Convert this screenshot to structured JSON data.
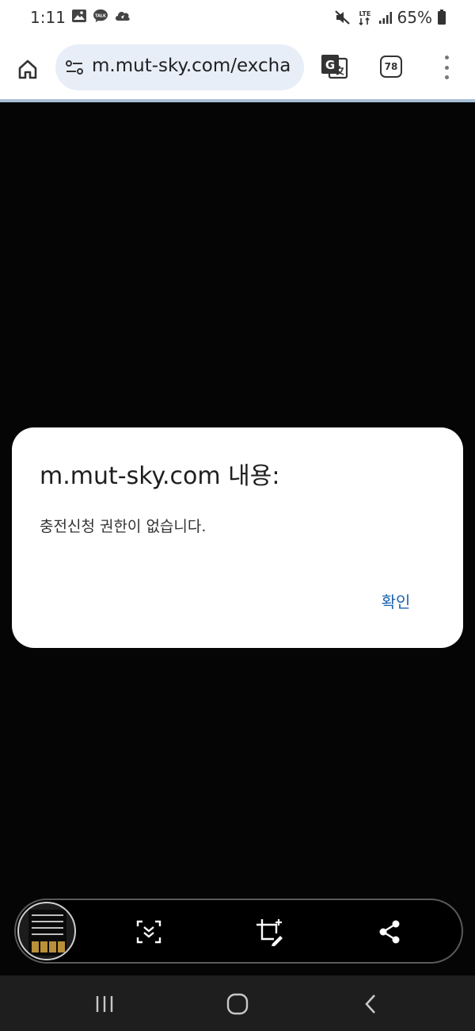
{
  "status_bar": {
    "time": "1:11",
    "talk_badge": "TALK",
    "network": "LTE",
    "battery_percent": "65%",
    "icons": [
      "gallery-icon",
      "kakaotalk-icon",
      "cloud-icon",
      "mute-icon",
      "lte-icon",
      "signal-icon",
      "battery-icon"
    ]
  },
  "browser": {
    "url": "m.mut-sky.com/excha",
    "tab_count": "78",
    "accent_line_color": "#a9bfd8"
  },
  "dialog": {
    "title": "m.mut-sky.com 내용:",
    "message": "충전신청 권한이 없습니다.",
    "ok_label": "확인",
    "ok_color": "#1a63b0"
  },
  "screenshot_toolbar": {
    "icons": [
      "screenshot-thumbnail",
      "scroll-capture-icon",
      "crop-edit-icon",
      "share-icon"
    ]
  },
  "nav_bar": {
    "icons": [
      "recents-icon",
      "home-icon",
      "back-icon"
    ]
  }
}
